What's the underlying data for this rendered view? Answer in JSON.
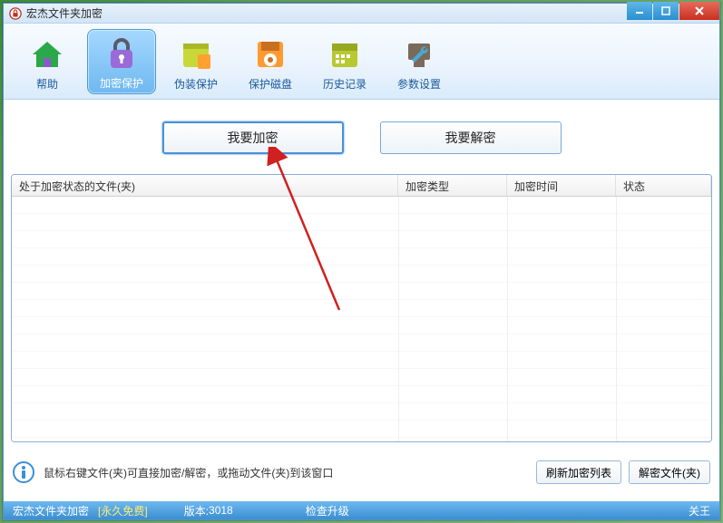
{
  "window": {
    "title": "宏杰文件夹加密"
  },
  "toolbar": {
    "help": "帮助",
    "encrypt": "加密保护",
    "disguise": "伪装保护",
    "disk": "保护磁盘",
    "history": "历史记录",
    "settings": "参数设置"
  },
  "actions": {
    "encrypt_btn": "我要加密",
    "decrypt_btn": "我要解密"
  },
  "table": {
    "col_file": "处于加密状态的文件(夹)",
    "col_type": "加密类型",
    "col_time": "加密时间",
    "col_status": "状态"
  },
  "footer": {
    "hint": "鼠标右键文件(夹)可直接加密/解密，或拖动文件(夹)到该窗口",
    "refresh": "刷新加密列表",
    "decrypt_file": "解密文件(夹)"
  },
  "status": {
    "product": "宏杰文件夹加密",
    "free": "[永久免费]",
    "version_label": "版本:",
    "version": "3018",
    "check_update": "检查升级",
    "attention": "关王"
  }
}
